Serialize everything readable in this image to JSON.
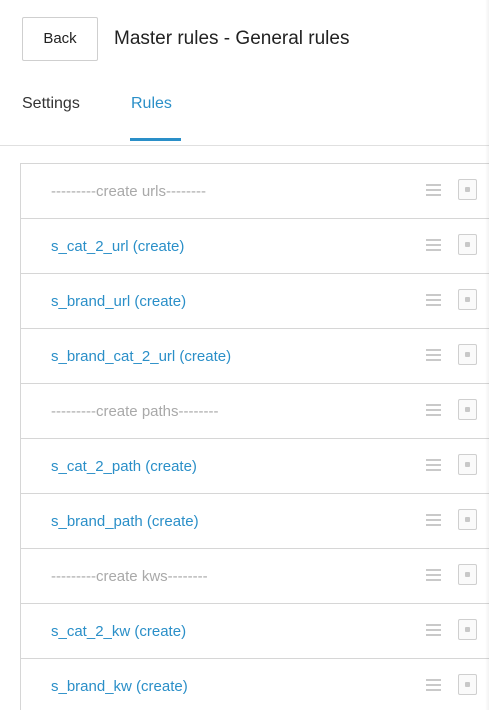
{
  "header": {
    "back_label": "Back",
    "title": "Master rules - General rules"
  },
  "tabs": [
    {
      "label": "Settings",
      "active": false
    },
    {
      "label": "Rules",
      "active": true
    }
  ],
  "colors": {
    "accent": "#2a8fc8",
    "section_text": "#a9a9a9",
    "border": "#d6d6d6"
  },
  "rules": [
    {
      "label": "---------create urls--------",
      "kind": "section"
    },
    {
      "label": "s_cat_2_url (create)",
      "kind": "link"
    },
    {
      "label": "s_brand_url (create)",
      "kind": "link"
    },
    {
      "label": "s_brand_cat_2_url (create)",
      "kind": "link"
    },
    {
      "label": "---------create paths--------",
      "kind": "section"
    },
    {
      "label": "s_cat_2_path (create)",
      "kind": "link"
    },
    {
      "label": "s_brand_path (create)",
      "kind": "link"
    },
    {
      "label": "---------create kws--------",
      "kind": "section"
    },
    {
      "label": "s_cat_2_kw (create)",
      "kind": "link"
    },
    {
      "label": "s_brand_kw (create)",
      "kind": "link"
    }
  ],
  "row_icons": {
    "handle": "drag-handle-icon",
    "checkbox": "checkbox-icon"
  }
}
